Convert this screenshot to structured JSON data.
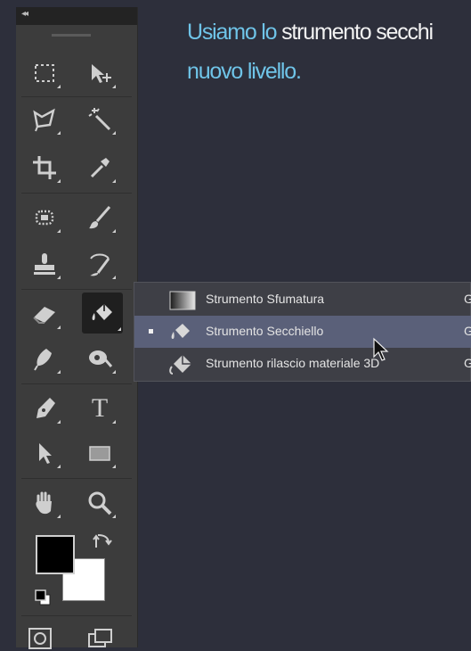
{
  "heading": {
    "accent": "Usiamo lo ",
    "main": "strumento secchi",
    "line2": "nuovo livello."
  },
  "toolbar": {
    "collapse_glyph": "◂◂",
    "tools": [
      {
        "name": "rectangular-marquee-icon"
      },
      {
        "name": "move-icon"
      },
      {
        "name": "lasso-icon"
      },
      {
        "name": "magic-wand-icon"
      },
      {
        "name": "crop-icon"
      },
      {
        "name": "eyedropper-icon"
      },
      {
        "name": "spot-healing-icon"
      },
      {
        "name": "brush-icon"
      },
      {
        "name": "clone-stamp-icon"
      },
      {
        "name": "history-brush-icon"
      },
      {
        "name": "eraser-icon"
      },
      {
        "name": "paint-bucket-icon",
        "active": true
      },
      {
        "name": "blur-icon"
      },
      {
        "name": "dodge-icon"
      },
      {
        "name": "pen-icon"
      },
      {
        "name": "type-icon",
        "glyph": "T"
      },
      {
        "name": "path-selection-icon"
      },
      {
        "name": "rectangle-shape-icon"
      },
      {
        "name": "hand-icon"
      },
      {
        "name": "zoom-icon"
      }
    ],
    "foreground_color": "#000000",
    "background_color": "#ffffff"
  },
  "flyout": {
    "items": [
      {
        "label": "Strumento Sfumatura",
        "shortcut": "G",
        "selected": false
      },
      {
        "label": "Strumento Secchiello",
        "shortcut": "G",
        "selected": true
      },
      {
        "label": "Strumento rilascio materiale 3D",
        "shortcut": "G",
        "selected": false
      }
    ]
  },
  "colors": {
    "accent": "#6fc4e8",
    "highlight": "#5a6079",
    "canvas": "#2d2f3b"
  }
}
